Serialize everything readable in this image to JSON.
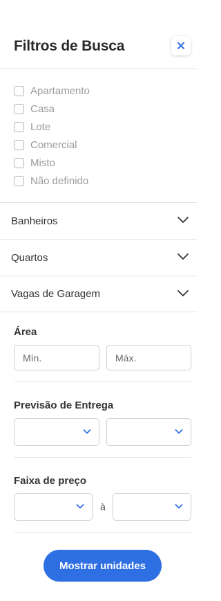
{
  "header": {
    "title": "Filtros de Busca"
  },
  "property_types": [
    {
      "label": "Apartamento",
      "checked": false
    },
    {
      "label": "Casa",
      "checked": false
    },
    {
      "label": "Lote",
      "checked": false
    },
    {
      "label": "Comercial",
      "checked": false
    },
    {
      "label": "Misto",
      "checked": false
    },
    {
      "label": "Não definido",
      "checked": false
    }
  ],
  "accordions": [
    {
      "label": "Banheiros"
    },
    {
      "label": "Quartos"
    },
    {
      "label": "Vagas de Garagem"
    }
  ],
  "area": {
    "title": "Área",
    "min_placeholder": "Mín.",
    "max_placeholder": "Máx."
  },
  "delivery": {
    "title": "Previsão de Entrega"
  },
  "price": {
    "title": "Faixa de preço",
    "separator": "à"
  },
  "submit_label": "Mostrar unidades",
  "colors": {
    "accent": "#2f6fe4",
    "text": "#2b2b2b",
    "muted": "#9a9a9a",
    "border": "#e3e3e3"
  }
}
